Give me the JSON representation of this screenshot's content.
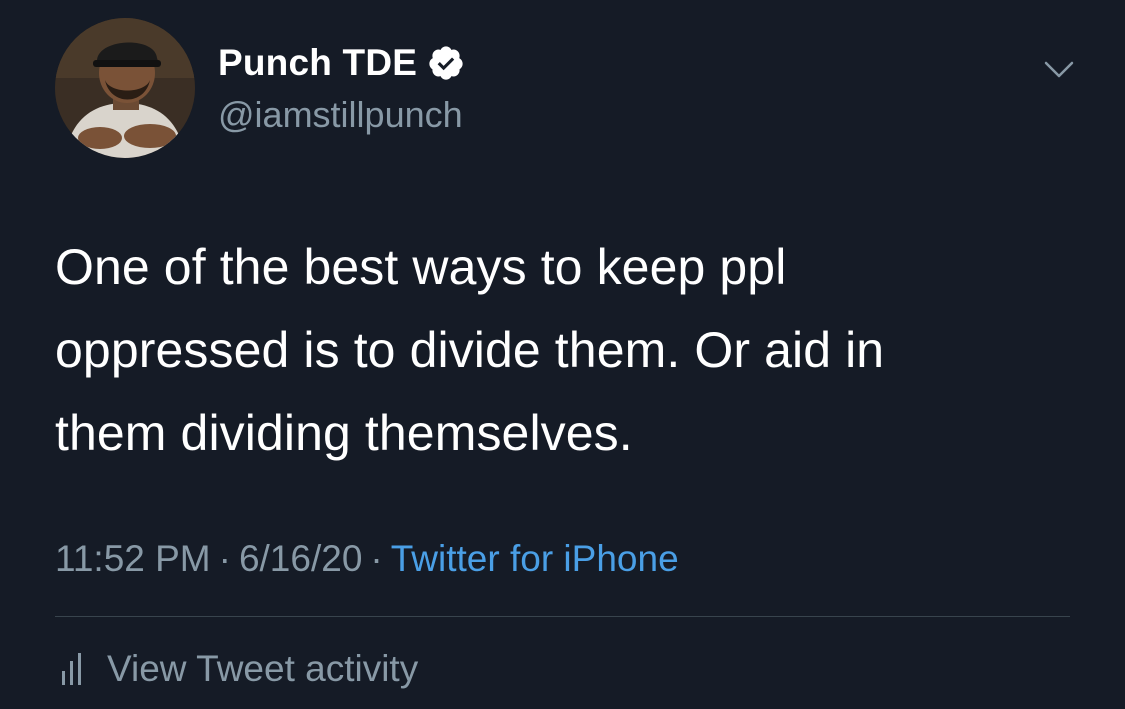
{
  "tweet": {
    "author": {
      "display_name": "Punch TDE",
      "handle": "@iamstillpunch",
      "verified": true
    },
    "text": "One of the best ways to keep ppl\noppressed is to divide them. Or aid in\nthem dividing themselves.",
    "meta": {
      "time": "11:52 PM",
      "separator_1": "·",
      "date": "6/16/20",
      "separator_2": "·",
      "source": "Twitter for iPhone"
    },
    "activity_label": "View Tweet activity"
  },
  "icons": {
    "verified": "verified-badge-icon",
    "more": "chevron-down-icon",
    "activity": "bar-chart-icon"
  },
  "colors": {
    "background": "#151b26",
    "text_primary": "#ffffff",
    "text_secondary": "#8899a6",
    "link": "#4a9fe6",
    "divider": "#38444d"
  }
}
